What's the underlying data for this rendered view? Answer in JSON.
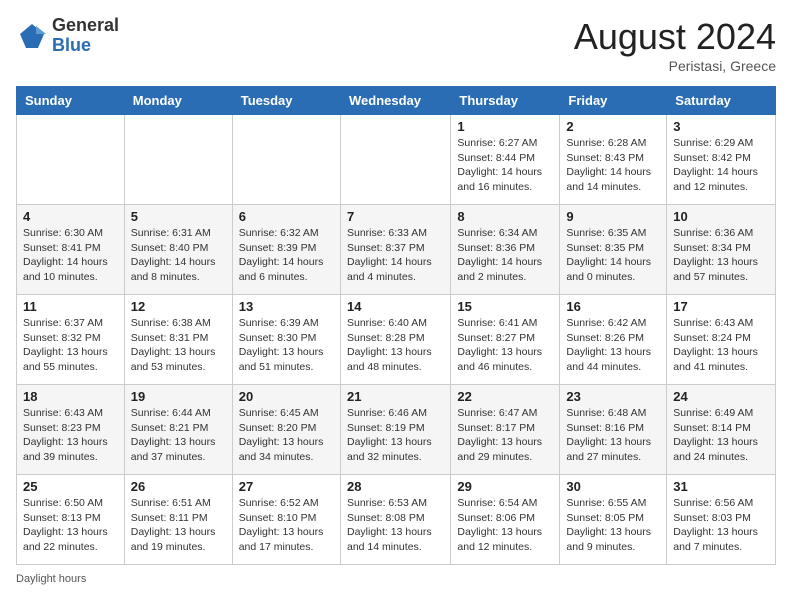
{
  "header": {
    "logo_general": "General",
    "logo_blue": "Blue",
    "month_year": "August 2024",
    "location": "Peristasi, Greece"
  },
  "days_of_week": [
    "Sunday",
    "Monday",
    "Tuesday",
    "Wednesday",
    "Thursday",
    "Friday",
    "Saturday"
  ],
  "weeks": [
    [
      {
        "day": "",
        "info": ""
      },
      {
        "day": "",
        "info": ""
      },
      {
        "day": "",
        "info": ""
      },
      {
        "day": "",
        "info": ""
      },
      {
        "day": "1",
        "info": "Sunrise: 6:27 AM\nSunset: 8:44 PM\nDaylight: 14 hours and 16 minutes."
      },
      {
        "day": "2",
        "info": "Sunrise: 6:28 AM\nSunset: 8:43 PM\nDaylight: 14 hours and 14 minutes."
      },
      {
        "day": "3",
        "info": "Sunrise: 6:29 AM\nSunset: 8:42 PM\nDaylight: 14 hours and 12 minutes."
      }
    ],
    [
      {
        "day": "4",
        "info": "Sunrise: 6:30 AM\nSunset: 8:41 PM\nDaylight: 14 hours and 10 minutes."
      },
      {
        "day": "5",
        "info": "Sunrise: 6:31 AM\nSunset: 8:40 PM\nDaylight: 14 hours and 8 minutes."
      },
      {
        "day": "6",
        "info": "Sunrise: 6:32 AM\nSunset: 8:39 PM\nDaylight: 14 hours and 6 minutes."
      },
      {
        "day": "7",
        "info": "Sunrise: 6:33 AM\nSunset: 8:37 PM\nDaylight: 14 hours and 4 minutes."
      },
      {
        "day": "8",
        "info": "Sunrise: 6:34 AM\nSunset: 8:36 PM\nDaylight: 14 hours and 2 minutes."
      },
      {
        "day": "9",
        "info": "Sunrise: 6:35 AM\nSunset: 8:35 PM\nDaylight: 14 hours and 0 minutes."
      },
      {
        "day": "10",
        "info": "Sunrise: 6:36 AM\nSunset: 8:34 PM\nDaylight: 13 hours and 57 minutes."
      }
    ],
    [
      {
        "day": "11",
        "info": "Sunrise: 6:37 AM\nSunset: 8:32 PM\nDaylight: 13 hours and 55 minutes."
      },
      {
        "day": "12",
        "info": "Sunrise: 6:38 AM\nSunset: 8:31 PM\nDaylight: 13 hours and 53 minutes."
      },
      {
        "day": "13",
        "info": "Sunrise: 6:39 AM\nSunset: 8:30 PM\nDaylight: 13 hours and 51 minutes."
      },
      {
        "day": "14",
        "info": "Sunrise: 6:40 AM\nSunset: 8:28 PM\nDaylight: 13 hours and 48 minutes."
      },
      {
        "day": "15",
        "info": "Sunrise: 6:41 AM\nSunset: 8:27 PM\nDaylight: 13 hours and 46 minutes."
      },
      {
        "day": "16",
        "info": "Sunrise: 6:42 AM\nSunset: 8:26 PM\nDaylight: 13 hours and 44 minutes."
      },
      {
        "day": "17",
        "info": "Sunrise: 6:43 AM\nSunset: 8:24 PM\nDaylight: 13 hours and 41 minutes."
      }
    ],
    [
      {
        "day": "18",
        "info": "Sunrise: 6:43 AM\nSunset: 8:23 PM\nDaylight: 13 hours and 39 minutes."
      },
      {
        "day": "19",
        "info": "Sunrise: 6:44 AM\nSunset: 8:21 PM\nDaylight: 13 hours and 37 minutes."
      },
      {
        "day": "20",
        "info": "Sunrise: 6:45 AM\nSunset: 8:20 PM\nDaylight: 13 hours and 34 minutes."
      },
      {
        "day": "21",
        "info": "Sunrise: 6:46 AM\nSunset: 8:19 PM\nDaylight: 13 hours and 32 minutes."
      },
      {
        "day": "22",
        "info": "Sunrise: 6:47 AM\nSunset: 8:17 PM\nDaylight: 13 hours and 29 minutes."
      },
      {
        "day": "23",
        "info": "Sunrise: 6:48 AM\nSunset: 8:16 PM\nDaylight: 13 hours and 27 minutes."
      },
      {
        "day": "24",
        "info": "Sunrise: 6:49 AM\nSunset: 8:14 PM\nDaylight: 13 hours and 24 minutes."
      }
    ],
    [
      {
        "day": "25",
        "info": "Sunrise: 6:50 AM\nSunset: 8:13 PM\nDaylight: 13 hours and 22 minutes."
      },
      {
        "day": "26",
        "info": "Sunrise: 6:51 AM\nSunset: 8:11 PM\nDaylight: 13 hours and 19 minutes."
      },
      {
        "day": "27",
        "info": "Sunrise: 6:52 AM\nSunset: 8:10 PM\nDaylight: 13 hours and 17 minutes."
      },
      {
        "day": "28",
        "info": "Sunrise: 6:53 AM\nSunset: 8:08 PM\nDaylight: 13 hours and 14 minutes."
      },
      {
        "day": "29",
        "info": "Sunrise: 6:54 AM\nSunset: 8:06 PM\nDaylight: 13 hours and 12 minutes."
      },
      {
        "day": "30",
        "info": "Sunrise: 6:55 AM\nSunset: 8:05 PM\nDaylight: 13 hours and 9 minutes."
      },
      {
        "day": "31",
        "info": "Sunrise: 6:56 AM\nSunset: 8:03 PM\nDaylight: 13 hours and 7 minutes."
      }
    ]
  ],
  "footer": {
    "note": "Daylight hours"
  }
}
